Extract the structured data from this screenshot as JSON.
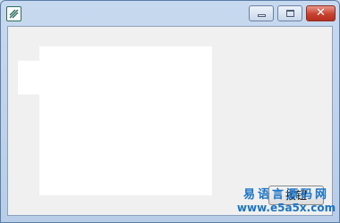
{
  "window": {
    "icon": "app-icon",
    "controls": {
      "minimize_icon": "minimize-icon",
      "maximize_icon": "maximize-icon",
      "close_glyph": "✕"
    }
  },
  "form": {
    "button_label": "按钮"
  },
  "watermark": {
    "title": "易语言源码网",
    "url": "www.e5a5x.com"
  }
}
